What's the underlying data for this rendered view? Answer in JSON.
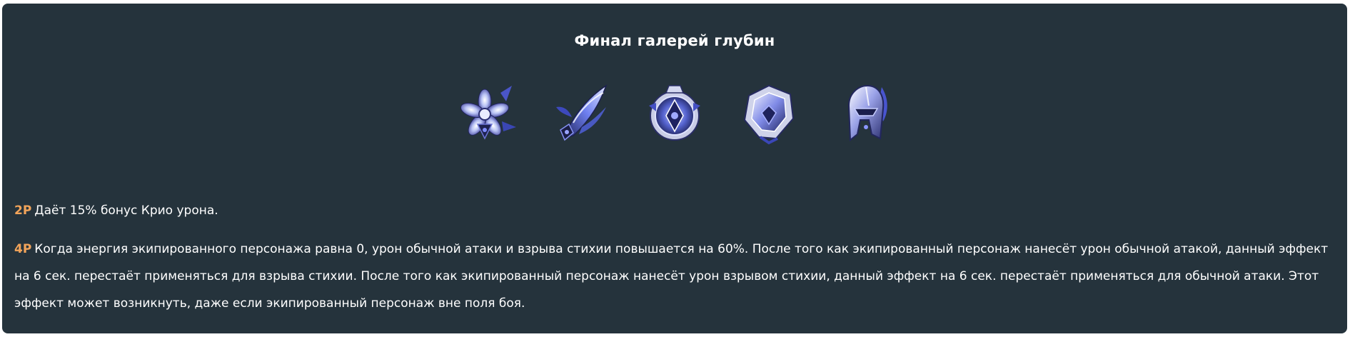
{
  "set": {
    "title": "Финал галерей глубин",
    "pieces": [
      {
        "icon": "flower-of-life-icon"
      },
      {
        "icon": "plume-of-death-icon"
      },
      {
        "icon": "sands-of-eon-icon"
      },
      {
        "icon": "goblet-of-eonothem-icon"
      },
      {
        "icon": "circlet-of-logos-icon"
      }
    ],
    "bonuses": [
      {
        "tag": "2P",
        "text": "Даёт 15% бонус Крио урона."
      },
      {
        "tag": "4P",
        "text": "Когда энергия экипированного персонажа равна 0, урон обычной атаки и взрыва стихии повышается на 60%. После того как экипированный персонаж нанесёт урон обычной атакой, данный эффект на 6 сек. перестаёт применяться для взрыва стихии. После того как экипированный персонаж нанесёт урон взрывом стихии, данный эффект на 6 сек. перестаёт применяться для обычной атаки. Этот эффект может возникнуть, даже если экипированный персонаж вне поля боя."
      }
    ],
    "colors": {
      "background": "#25333c",
      "tag": "#f2a45a",
      "text": "#ffffff"
    }
  }
}
